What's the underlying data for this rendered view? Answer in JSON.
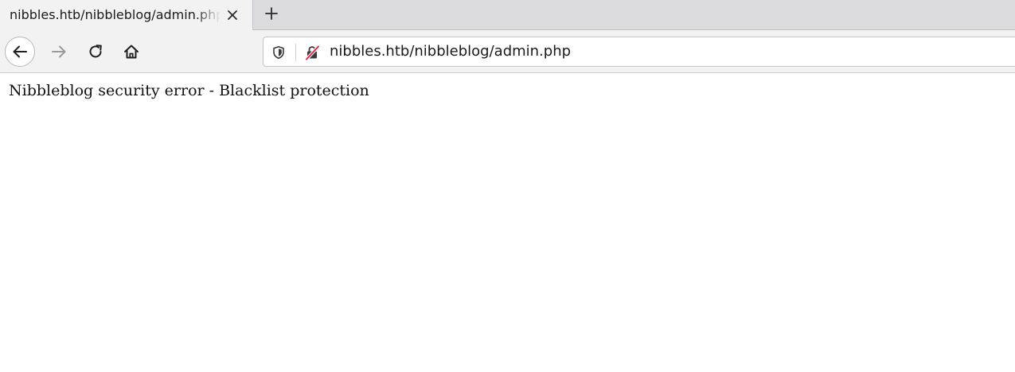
{
  "tab": {
    "title": "nibbles.htb/nibbleblog/admin.php",
    "close_icon": "close-icon"
  },
  "tabstrip": {
    "new_tab_icon": "plus-icon"
  },
  "toolbar": {
    "back_icon": "arrow-left-icon",
    "forward_icon": "arrow-right-icon",
    "reload_icon": "reload-icon",
    "home_icon": "home-icon"
  },
  "urlbar": {
    "shield_icon": "shield-icon",
    "insecure_lock_icon": "insecure-lock-icon",
    "url": "nibbles.htb/nibbleblog/admin.php",
    "insecure_color": "#e22850"
  },
  "page": {
    "message": "Nibbleblog security error - Blacklist protection"
  }
}
